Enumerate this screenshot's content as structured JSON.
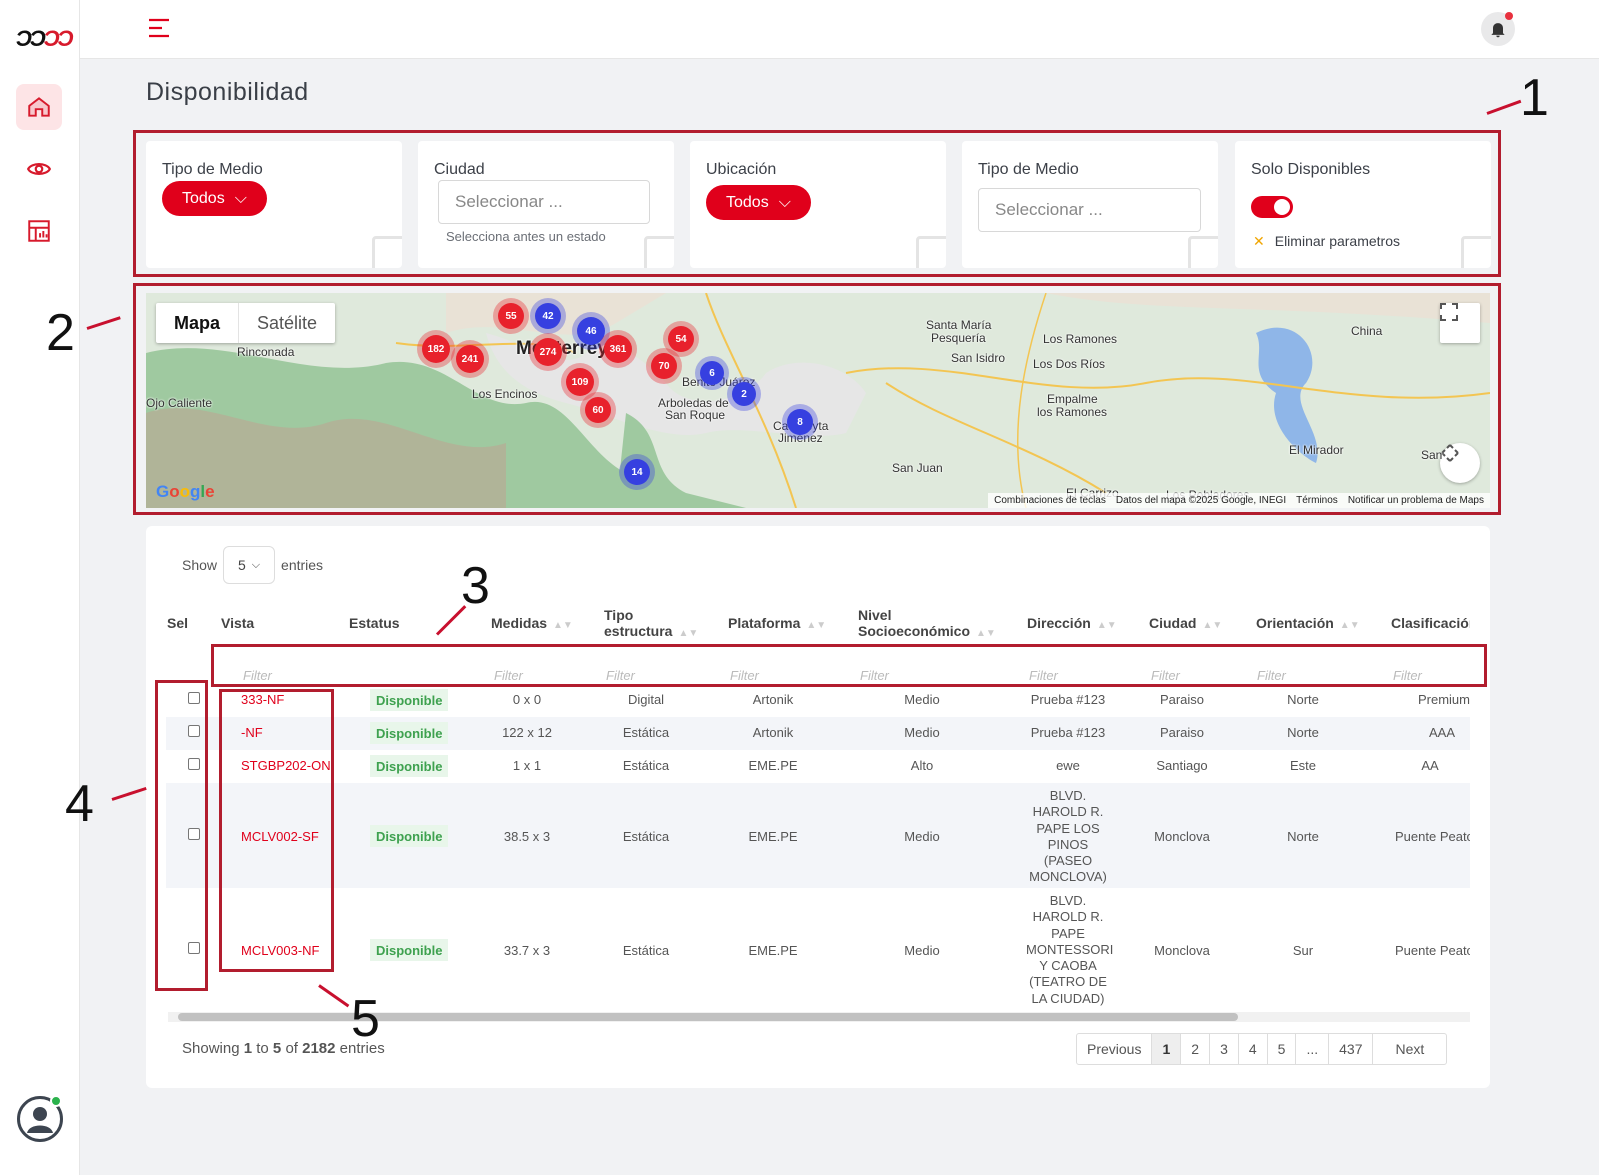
{
  "app": {
    "logo_text": "ƆƆƆ"
  },
  "sidebar": {
    "items": [
      {
        "icon": "home-icon"
      },
      {
        "icon": "eye-icon"
      },
      {
        "icon": "dashboard-icon"
      }
    ]
  },
  "page": {
    "title": "Disponibilidad"
  },
  "filters": {
    "tipo_medio": {
      "label": "Tipo de Medio",
      "value": "Todos"
    },
    "ciudad": {
      "label": "Ciudad",
      "placeholder": "Seleccionar ...",
      "hint": "Selecciona antes un estado"
    },
    "ubicacion": {
      "label": "Ubicación",
      "value": "Todos"
    },
    "tipo_medio_2": {
      "label": "Tipo de Medio",
      "placeholder": "Seleccionar ..."
    },
    "solo_disponibles": {
      "label": "Solo Disponibles",
      "clear_label": "Eliminar parametros"
    }
  },
  "map": {
    "tab_map": "Mapa",
    "tab_sat": "Satélite",
    "google": "Google",
    "places": [
      "Monterrey",
      "Santa María",
      "Pesquería",
      "San Isidro",
      "Los Ramones",
      "Los Dos Ríos",
      "China",
      "Rinconada",
      "Los Encinos",
      "Arboledas de",
      "San Roque",
      "Benito Juárez",
      "Cadereyta",
      "Jiménez",
      "Empalme",
      "los Ramones",
      "El Mirador",
      "San Juan",
      "Ojo Caliente",
      "El Carrizo",
      "Los Pobladores",
      "San"
    ],
    "clusters": [
      "55",
      "42",
      "46",
      "182",
      "241",
      "274",
      "361",
      "54",
      "70",
      "109",
      "60",
      "6",
      "2",
      "8",
      "14"
    ],
    "attribution": [
      "Combinaciones de teclas",
      "Datos del mapa ©2025 Google, INEGI",
      "Términos",
      "Notificar un problema de Maps"
    ]
  },
  "table": {
    "show_label": "Show",
    "entries_label": "entries",
    "page_size": "5",
    "filter_placeholder": "Filter",
    "columns": [
      "Sel",
      "Vista",
      "Estatus",
      "Medidas",
      "Tipo estructura",
      "Plataforma",
      "Nivel Socioeconómico",
      "Dirección",
      "Ciudad",
      "Orientación",
      "Clasificación"
    ],
    "rows": [
      {
        "vista": "333-NF",
        "estatus": "Disponible",
        "medidas": "0 x 0",
        "tipo": "Digital",
        "plataforma": "Artonik",
        "nivel": "Medio",
        "direccion": "Prueba #123",
        "ciudad": "Paraiso",
        "orientacion": "Norte",
        "clasificacion": "Premium"
      },
      {
        "vista": "-NF",
        "estatus": "Disponible",
        "medidas": "122 x 12",
        "tipo": "Estática",
        "plataforma": "Artonik",
        "nivel": "Medio",
        "direccion": "Prueba #123",
        "ciudad": "Paraiso",
        "orientacion": "Norte",
        "clasificacion": "AAA"
      },
      {
        "vista": "STGBP202-ON",
        "estatus": "Disponible",
        "medidas": "1 x 1",
        "tipo": "Estática",
        "plataforma": "EME.PE",
        "nivel": "Alto",
        "direccion": "ewe",
        "ciudad": "Santiago",
        "orientacion": "Este",
        "clasificacion": "AA"
      },
      {
        "vista": "MCLV002-SF",
        "estatus": "Disponible",
        "medidas": "38.5 x 3",
        "tipo": "Estática",
        "plataforma": "EME.PE",
        "nivel": "Medio",
        "direccion": "BLVD. HAROLD R. PAPE LOS PINOS (PASEO MONCLOVA)",
        "ciudad": "Monclova",
        "orientacion": "Norte",
        "clasificacion": "Puente Peato"
      },
      {
        "vista": "MCLV003-NF",
        "estatus": "Disponible",
        "medidas": "33.7 x 3",
        "tipo": "Estática",
        "plataforma": "EME.PE",
        "nivel": "Medio",
        "direccion": "BLVD. HAROLD R. PAPE MONTESSORI Y CAOBA (TEATRO DE LA CIUDAD)",
        "ciudad": "Monclova",
        "orientacion": "Sur",
        "clasificacion": "Puente Peato"
      }
    ],
    "showing": {
      "prefix": "Showing",
      "from": "1",
      "to_word": "to",
      "to": "5",
      "of_word": "of",
      "total": "2182",
      "suffix": "entries"
    },
    "pager": [
      "Previous",
      "1",
      "2",
      "3",
      "4",
      "5",
      "...",
      "437",
      "Next"
    ]
  },
  "annotations": [
    "1",
    "2",
    "3",
    "4",
    "5"
  ],
  "colors": {
    "accent": "#e0001b",
    "annotation": "#b21d2e"
  }
}
